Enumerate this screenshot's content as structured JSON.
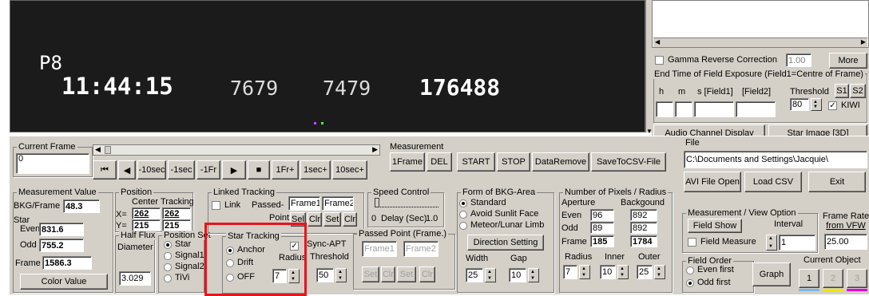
{
  "video": {
    "label": "P8",
    "timecode": "11:44:15",
    "num1": "7679",
    "num2": "7479",
    "num3": "176488"
  },
  "right_top": {
    "gamma_label": "Gamma Reverse Correction",
    "gamma_value": "1.00",
    "more_label": "More",
    "end_time_title": "End Time of Field Exposure (Field1=Centre of Frame)",
    "col_h": "h",
    "col_m": "m",
    "col_s": "s [Field1]",
    "col_field2": "[Field2]",
    "threshold_label": "Threshold",
    "s1_label": "S1",
    "s2_label": "S2",
    "threshold_value": "80",
    "kiwi_label": "KIWI",
    "audio_label": "Audio Channel Display",
    "star_image_label": "Star Image [3D]"
  },
  "current_frame": {
    "title": "Current Frame",
    "value": "0"
  },
  "nav": {
    "first": "⏮",
    "prev": "◀",
    "m10sec": "-10sec",
    "m1sec": "-1sec",
    "m1fr": "-1Fr",
    "play": "▶",
    "stop": "■",
    "p1fr": "1Fr+",
    "p1sec": "1sec+",
    "p10sec": "10sec+"
  },
  "measurement": {
    "title": "Measurement",
    "frame1": "1Frame",
    "del": "DEL",
    "start": "START",
    "stop": "STOP",
    "data_remove": "DataRemove",
    "save_csv": "SaveToCSV-File"
  },
  "file": {
    "title": "File",
    "path": "C:\\Documents and Settings\\Jacquie\\",
    "avi_open": "AVI File Open",
    "load_csv": "Load CSV",
    "exit": "Exit"
  },
  "meas_value": {
    "title": "Measurement Value",
    "bkg_label": "BKG/Frame",
    "bkg_value": "48.3",
    "star_label": "Star",
    "even_label": "Even",
    "even_value": "831.6",
    "odd_label": "Odd",
    "odd_value": "755.2",
    "frame_label": "Frame",
    "frame_value": "1586.3",
    "color_value": "Color Value"
  },
  "position": {
    "title": "Position",
    "center_label": "Center",
    "tracking_label": "Tracking",
    "x_label": "X=",
    "x_center": "262",
    "x_tracking": "262",
    "y_label": "Y=",
    "y_center": "215",
    "y_tracking": "215"
  },
  "half_flux": {
    "title": "Half Flux",
    "diameter": "Diameter",
    "value": "3.029"
  },
  "position_set": {
    "title": "Position Set",
    "opt_star": "Star",
    "opt_signal1": "Signal1",
    "opt_signal2": "Signal2",
    "opt_tivi": "TiVi"
  },
  "linked": {
    "title": "Linked Tracking",
    "link_label": "Link",
    "passed_label": "Passed-",
    "point_label": "Point",
    "frame1": "Frame1",
    "frame2": "Frame2",
    "sel": "Sel",
    "clr": "Clr",
    "set": "Set",
    "clr2": "Clr"
  },
  "star_tracking": {
    "title": "Star Tracking",
    "anchor": "Anchor",
    "drift": "Drift",
    "off": "OFF",
    "sync_apt": "Sync-APT",
    "radius_label": "Radius",
    "threshold_label": "Threshold",
    "radius_value": "7",
    "threshold_value": "50"
  },
  "speed": {
    "title": "Speed Control",
    "delay_min": "0",
    "delay_label": "Delay (Sec)",
    "delay_max": "1.0"
  },
  "passed_point": {
    "title": "Passed Point (Frame.)",
    "frame1": "Frame1",
    "frame2": "Frame2",
    "set1": "Set",
    "clr1": "Clr",
    "set2": "Set",
    "clr2": "Clr"
  },
  "bkg_area": {
    "title": "Form of BKG-Area",
    "standard": "Standard",
    "avoid_sunlit": "Avoid Sunlit Face",
    "meteor": "Meteor/Lunar Limb",
    "direction": "Direction Setting",
    "width_label": "Width",
    "gap_label": "Gap",
    "width_value": "25",
    "gap_value": "10"
  },
  "pixels": {
    "title": "Number of Pixels / Radius",
    "aperture": "Aperture",
    "background": "Backgound",
    "even_label": "Even",
    "even_ap": "96",
    "even_bg": "892",
    "odd_label": "Odd",
    "odd_ap": "89",
    "odd_bg": "892",
    "frame_label": "Frame",
    "frame_ap": "185",
    "frame_bg": "1784",
    "radius_label": "Radius",
    "inner_label": "Inner",
    "outer_label": "Outer",
    "radius_value": "7",
    "inner_value": "10",
    "outer_value": "25"
  },
  "view_option": {
    "title": "Measurement / View Option",
    "field_show": "Field Show",
    "interval_label": "Interval",
    "field_measure": "Field Measure",
    "interval_value": "1",
    "frame_rate_label1": "Frame Rate",
    "frame_rate_label2": "from VFW",
    "frame_rate_value": "25.00"
  },
  "field_order": {
    "title": "Field Order",
    "even_first": "Even first",
    "odd_first": "Odd first",
    "graph": "Graph"
  },
  "current_object": {
    "title": "Current Object",
    "obj1": "1",
    "obj2": "2",
    "obj3": "3"
  },
  "colors": {
    "panel": "#d4d0c8",
    "highlight": "#e8141c",
    "video_bg": "#1b1b1b",
    "obj1": "#7fb7e8",
    "obj2": "#f2e600",
    "obj3": "#e000e0"
  }
}
